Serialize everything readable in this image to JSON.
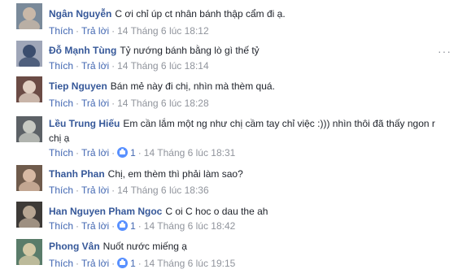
{
  "actions": {
    "like": "Thích",
    "reply": "Trả lời"
  },
  "more_glyph": "···",
  "comments": [
    {
      "name": "Ngân Nguyễn",
      "text": "C ơi chỉ úp ct nhân bánh thập cẩm đi ạ.",
      "time": "14 Tháng 6 lúc 18:12",
      "likes": ""
    },
    {
      "name": "Đỗ Mạnh Tùng",
      "text": "Tỷ nướng bánh bằng lò gì thế tỷ",
      "time": "14 Tháng 6 lúc 18:14",
      "likes": ""
    },
    {
      "name": "Tiep Nguyen",
      "text": "Bán mẻ này đi chị, nhìn mà thèm quá.",
      "time": "14 Tháng 6 lúc 18:28",
      "likes": ""
    },
    {
      "name": "Lều Trung Hiếu",
      "text": "Em cần lắm một ng như chị cầm tay chỉ việc :))) nhìn thôi đã thấy ngon r chị ạ",
      "time": "14 Tháng 6 lúc 18:31",
      "likes": "1"
    },
    {
      "name": "Thanh Phan",
      "text": "Chị, em thèm thì phải làm sao?",
      "time": "14 Tháng 6 lúc 18:36",
      "likes": ""
    },
    {
      "name": "Han Nguyen Pham Ngoc",
      "text": "C oi C hoc o dau the ah",
      "time": "14 Tháng 6 lúc 18:42",
      "likes": "1"
    },
    {
      "name": "Phong Vân",
      "text": "Nuốt nước miếng ạ",
      "time": "14 Tháng 6 lúc 19:15",
      "likes": "1"
    }
  ]
}
